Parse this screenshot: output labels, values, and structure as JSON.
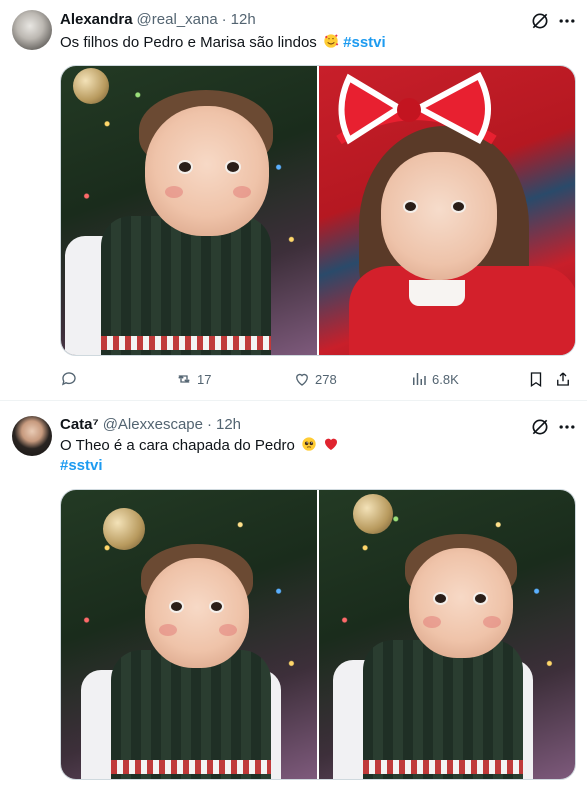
{
  "tweets": [
    {
      "author": {
        "name": "Alexandra",
        "handle": "@real_xana",
        "time": "12h"
      },
      "text": "Os filhos do Pedro e Marisa são lindos",
      "hashtag": "#sstvi",
      "emoji": "smiling-face-with-hearts",
      "media": [
        "photo-baby-christmas-tree",
        "photo-girl-red-bow"
      ],
      "metrics": {
        "replies": "",
        "reposts": "17",
        "likes": "278",
        "views": "6.8K"
      }
    },
    {
      "author": {
        "name": "Cata⁷",
        "handle": "@Alexxescape",
        "time": "12h"
      },
      "text": "O Theo é a cara chapada do Pedro",
      "hashtag": "#sstvi",
      "emoji": [
        "pleading-face",
        "red-heart"
      ],
      "media": [
        "photo-baby-christmas-tree-1",
        "photo-baby-christmas-tree-2"
      ]
    }
  ],
  "separator_dot": "·",
  "icons": {
    "grok": "grok-icon",
    "more": "more-icon",
    "reply": "reply-icon",
    "repost": "repost-icon",
    "like": "like-icon",
    "views": "views-icon",
    "bookmark": "bookmark-icon",
    "share": "share-icon"
  },
  "colors": {
    "text": "#0f1419",
    "secondary": "#536471",
    "link": "#1d9bf0",
    "border": "#eff3f4"
  }
}
